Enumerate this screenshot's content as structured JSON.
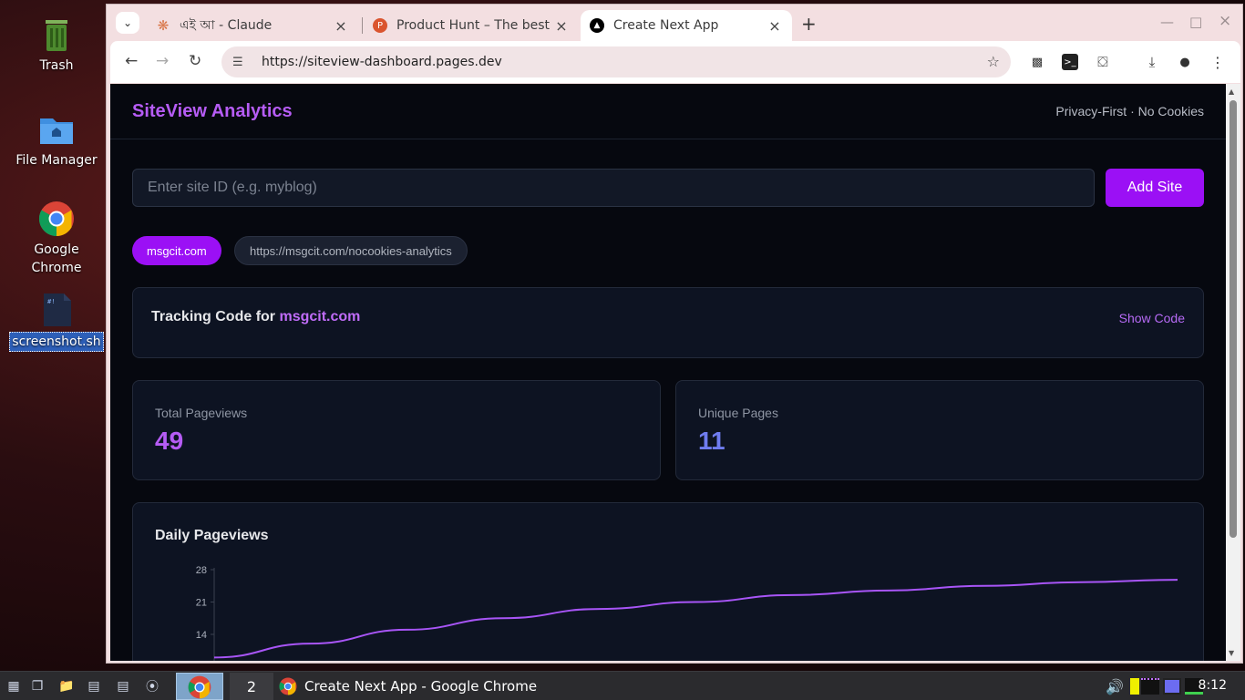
{
  "desktop": {
    "icons": [
      {
        "label": "Trash"
      },
      {
        "label": "File Manager"
      },
      {
        "label": "Google Chrome"
      },
      {
        "label": "screenshot.sh"
      }
    ]
  },
  "browser": {
    "tabs": [
      {
        "title": "এই আ - Claude",
        "icon": "claude-icon"
      },
      {
        "title": "Product Hunt – The best",
        "icon": "producthunt-icon"
      },
      {
        "title": "Create Next App",
        "icon": "nextjs-icon"
      }
    ],
    "url": "https://siteview-dashboard.pages.dev"
  },
  "app": {
    "brand": "SiteView Analytics",
    "tagline": "Privacy-First · No Cookies",
    "site_input_placeholder": "Enter site ID (e.g. myblog)",
    "add_site_label": "Add Site",
    "site_chips": [
      "msgcit.com",
      "https://msgcit.com/nocookies-analytics"
    ],
    "tracking": {
      "prefix": "Tracking Code for",
      "site": "msgcit.com",
      "show_code": "Show Code"
    },
    "stats": [
      {
        "label": "Total Pageviews",
        "value": "49",
        "color": "#b65cf5"
      },
      {
        "label": "Unique Pages",
        "value": "11",
        "color": "#6f7cf0"
      }
    ],
    "chart_title": "Daily Pageviews"
  },
  "chart_data": {
    "type": "line",
    "title": "Daily Pageviews",
    "yticks": [
      28,
      21,
      14
    ],
    "ylim": [
      0,
      28
    ],
    "series": [
      {
        "values": [
          9,
          12,
          15,
          17.5,
          19.5,
          21,
          22.5,
          23.5,
          24.5,
          25.3,
          25.8
        ]
      }
    ],
    "line_color": "#a855f7",
    "grid": false
  },
  "taskbar": {
    "workspace": "2",
    "task_title": "Create Next App - Google Chrome",
    "clock": "8:12"
  }
}
